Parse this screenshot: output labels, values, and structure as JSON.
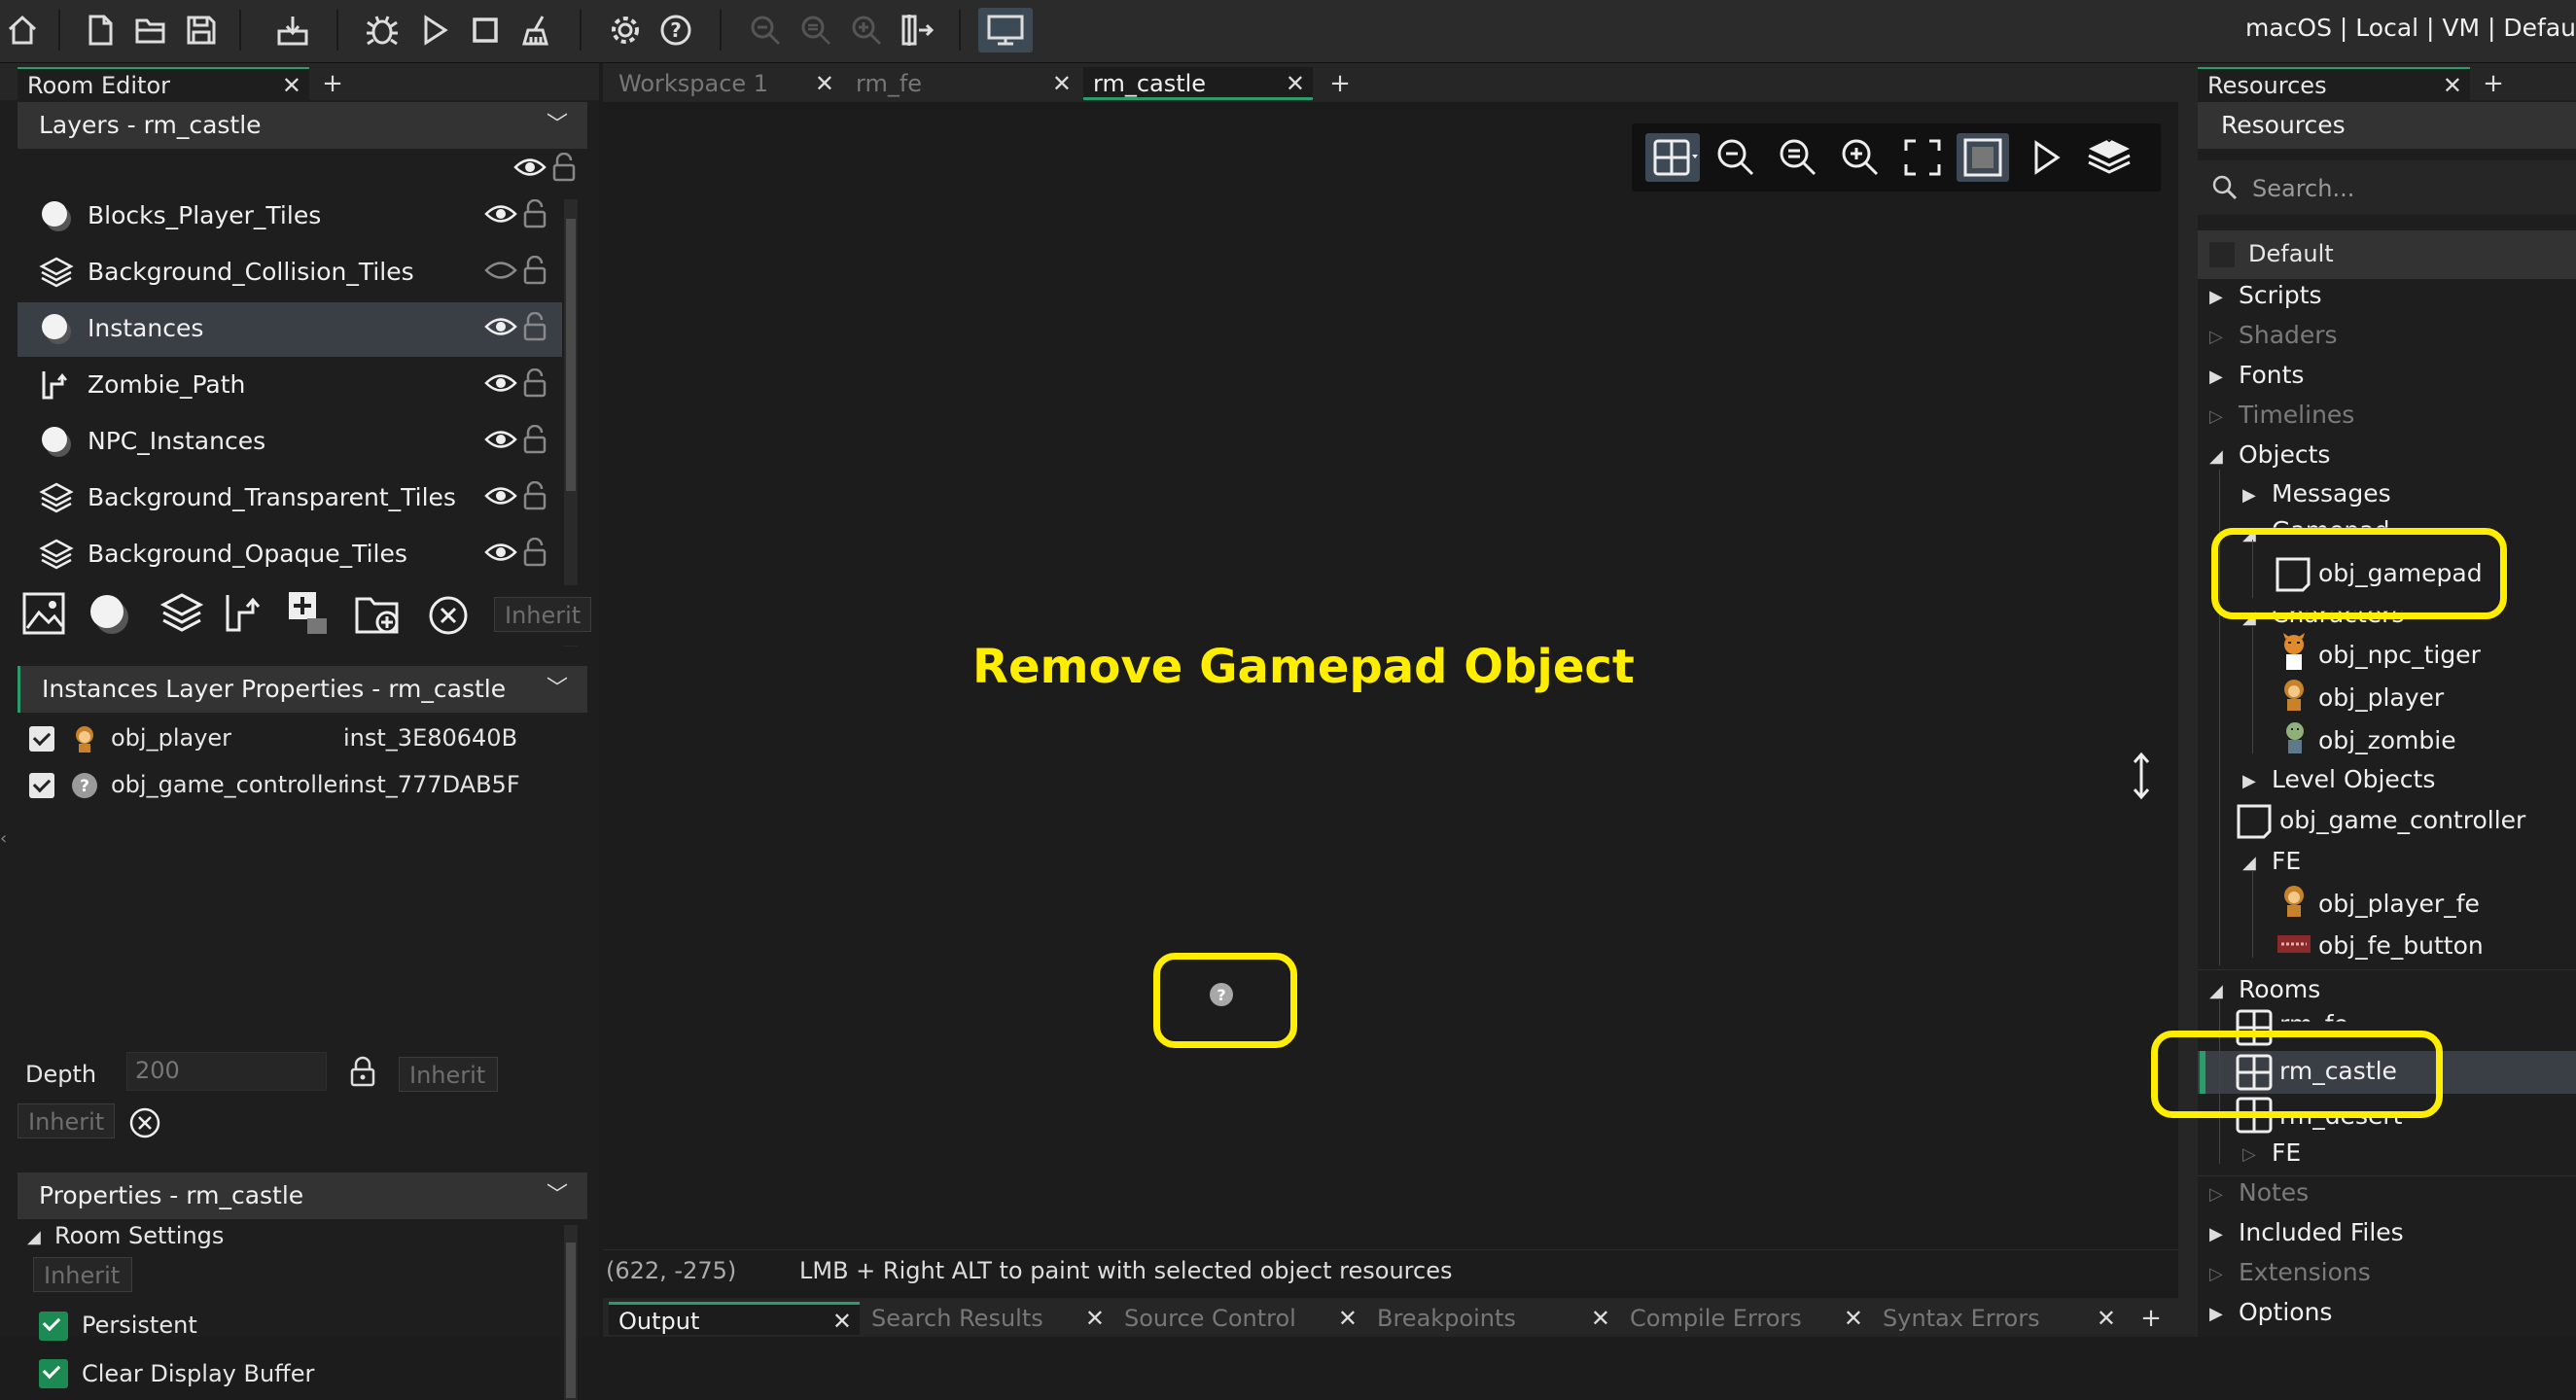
{
  "toolbar": {
    "buttons": [
      "home-icon",
      "new-project-icon",
      "open-project-icon",
      "save-project-icon",
      "create-executable-icon",
      "debug-icon",
      "run-icon",
      "stop-icon",
      "clean-icon",
      "preferences-icon",
      "help-icon",
      "zoom-out-icon",
      "zoom-reset-icon",
      "zoom-in-icon",
      "workspace-resize-icon",
      "monitor-icon"
    ],
    "target_info": "macOS | Local | VM | Defau"
  },
  "room_editor": {
    "tab_label": "Room Editor",
    "layers_header": "Layers - rm_castle",
    "layers": [
      {
        "name": "Blocks_Player_Tiles",
        "icon": "instance-layer-icon",
        "visible": true
      },
      {
        "name": "Background_Collision_Tiles",
        "icon": "tile-layer-icon",
        "visible": false
      },
      {
        "name": "Instances",
        "icon": "instance-layer-icon",
        "visible": true,
        "selected": true
      },
      {
        "name": "Zombie_Path",
        "icon": "path-layer-icon",
        "visible": true
      },
      {
        "name": "NPC_Instances",
        "icon": "instance-layer-icon",
        "visible": true
      },
      {
        "name": "Background_Transparent_Tiles",
        "icon": "tile-layer-icon",
        "visible": true
      },
      {
        "name": "Background_Opaque_Tiles",
        "icon": "tile-layer-icon",
        "visible": true
      }
    ],
    "layer_toolbar_inherit": "Inherit",
    "instances_header": "Instances Layer Properties - rm_castle",
    "instances": [
      {
        "object": "obj_player",
        "id": "inst_3E80640B"
      },
      {
        "object": "obj_game_controller",
        "id": "inst_777DAB5F"
      }
    ],
    "depth_label": "Depth",
    "depth_value": "200",
    "inherit_label": "Inherit",
    "properties_header": "Properties - rm_castle",
    "room_settings_label": "Room Settings",
    "persistent_label": "Persistent",
    "clear_display_label": "Clear Display Buffer"
  },
  "editor_tabs": [
    {
      "label": "Workspace 1",
      "active": false
    },
    {
      "label": "rm_fe",
      "active": false
    },
    {
      "label": "rm_castle",
      "active": true
    }
  ],
  "canvas": {
    "annotation": "Remove Gamepad Object",
    "status_coords": "(622, -275)",
    "status_hint": "LMB + Right ALT to paint with selected object resources"
  },
  "bottom_tabs": [
    "Output",
    "Search Results",
    "Source Control",
    "Breakpoints",
    "Compile Errors",
    "Syntax Errors"
  ],
  "resources": {
    "tab_label": "Resources",
    "title": "Resources",
    "search_placeholder": "Search...",
    "group": "Default",
    "tree": {
      "scripts": "Scripts",
      "shaders": "Shaders",
      "fonts": "Fonts",
      "timelines": "Timelines",
      "objects": "Objects",
      "messages": "Messages",
      "gamepad": "Gamepad",
      "obj_gamepad": "obj_gamepad",
      "characters": "Characters",
      "obj_npc_tiger": "obj_npc_tiger",
      "obj_player": "obj_player",
      "obj_zombie": "obj_zombie",
      "level_objects": "Level Objects",
      "obj_game_controller": "obj_game_controller",
      "fe": "FE",
      "obj_player_fe": "obj_player_fe",
      "obj_fe_button": "obj_fe_button",
      "rooms": "Rooms",
      "rm_fe": "rm_fe",
      "rm_castle": "rm_castle",
      "rm_desert": "rm_desert",
      "rooms_fe": "FE",
      "notes": "Notes",
      "included_files": "Included Files",
      "extensions": "Extensions",
      "options": "Options"
    }
  },
  "colors": {
    "highlight": "#ffee00",
    "accent": "#2a9d6a",
    "selection": "#3a3f46"
  }
}
